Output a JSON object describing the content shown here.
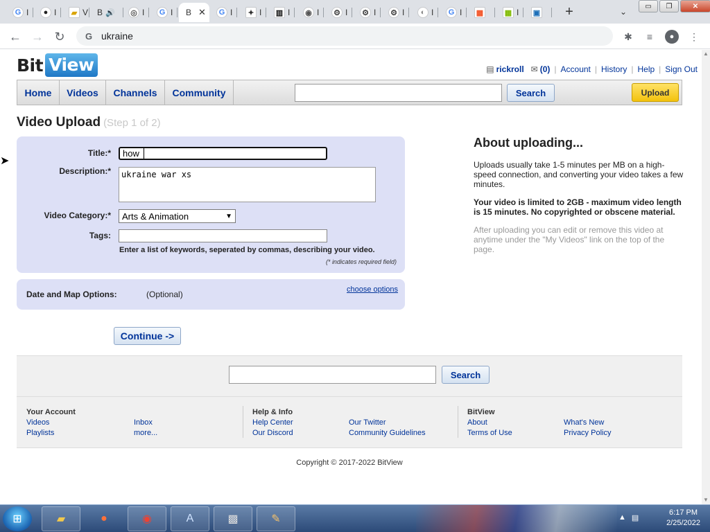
{
  "browser": {
    "tabs": [
      {
        "label": "G",
        "letter": "I"
      },
      {
        "label": "",
        "letter": "I"
      },
      {
        "label": "",
        "letter": "V"
      },
      {
        "label": "B",
        "letter": ""
      },
      {
        "label": "",
        "letter": "I"
      },
      {
        "label": "G",
        "letter": "I"
      },
      {
        "label": "B",
        "letter": "",
        "active": true
      },
      {
        "label": "G",
        "letter": "I"
      },
      {
        "label": "",
        "letter": "I"
      },
      {
        "label": "",
        "letter": "I"
      },
      {
        "label": "",
        "letter": "I"
      },
      {
        "label": "",
        "letter": "I"
      },
      {
        "label": "",
        "letter": "I"
      },
      {
        "label": "",
        "letter": "I"
      },
      {
        "label": "",
        "letter": "I"
      },
      {
        "label": "G",
        "letter": "I"
      },
      {
        "label": "",
        "letter": ""
      },
      {
        "label": "",
        "letter": "I"
      },
      {
        "label": "",
        "letter": ""
      }
    ],
    "address": "ukraine",
    "window_controls": {
      "minimize": "▭",
      "restore": "❐",
      "close": "✕"
    }
  },
  "site": {
    "logo_part1": "Bit",
    "logo_part2": "View",
    "user": {
      "username": "rickroll",
      "inbox_count": "(0)",
      "links": [
        "Account",
        "History",
        "Help",
        "Sign Out"
      ]
    },
    "nav": {
      "items": [
        "Home",
        "Videos",
        "Channels",
        "Community"
      ],
      "search_button": "Search",
      "upload_button": "Upload"
    }
  },
  "upload": {
    "heading": "Video Upload",
    "step": "(Step 1 of 2)",
    "title_label": "Title:*",
    "title_value": "how",
    "description_label": "Description:*",
    "description_value": "ukraine war xs",
    "category_label": "Video Category:*",
    "category_value": "Arts & Animation",
    "tags_label": "Tags:",
    "tags_value": "",
    "tags_hint": "Enter a list of keywords, seperated by commas, describing your video.",
    "required_note": "(* indicates required field)",
    "date_map_label": "Date and Map Options:",
    "date_map_optional": "(Optional)",
    "choose_options": "choose options",
    "continue_button": "Continue ->"
  },
  "about": {
    "title": "About uploading...",
    "p1": "Uploads usually take 1-5 minutes per MB on a high-speed connection, and converting your video takes a few minutes.",
    "p2": "Your video is limited to 2GB - maximum video length is 15 minutes. No copyrighted or obscene material.",
    "p3": "After uploading you can edit or remove this video at anytime under the \"My Videos\" link on the top of the page."
  },
  "footer": {
    "search_button": "Search",
    "col1_title": "Your Account",
    "col1_links": [
      "Videos",
      "Playlists",
      "Inbox",
      "more..."
    ],
    "col2_title": "Help & Info",
    "col2_links": [
      "Help Center",
      "Our Discord",
      "Our Twitter",
      "Community Guidelines"
    ],
    "col3_title": "BitView",
    "col3_links": [
      "About",
      "Terms of Use",
      "What's New",
      "Privacy Policy"
    ],
    "copyright": "Copyright © 2017-2022 BitView"
  },
  "taskbar": {
    "time": "6:17 PM",
    "date": "2/25/2022"
  },
  "colors": {
    "link": "#003399",
    "form_bg": "#dde0f6",
    "upload_yellow": "#f3c20d"
  }
}
